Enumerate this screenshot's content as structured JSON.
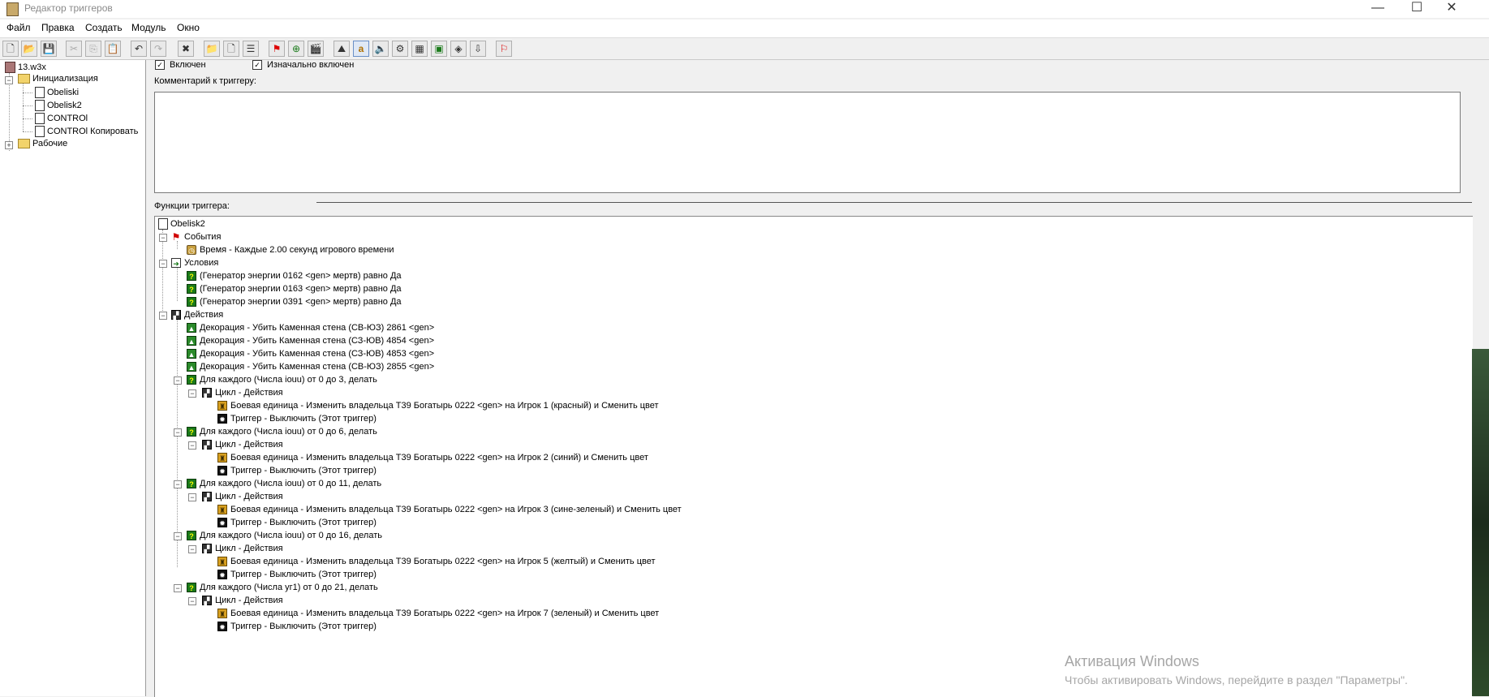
{
  "window": {
    "title": "Редактор триггеров",
    "minimize_glyph": "—",
    "maximize_glyph": "☐",
    "close_glyph": "✕"
  },
  "menu": [
    "Файл",
    "Правка",
    "Создать",
    "Модуль",
    "Окно"
  ],
  "toolbar": {
    "buttons": [
      {
        "name": "new-icon",
        "glyph": "🗋"
      },
      {
        "name": "open-icon",
        "glyph": "📂"
      },
      {
        "name": "save-icon",
        "glyph": "💾"
      },
      {
        "name": "cut-icon",
        "glyph": "✂"
      },
      {
        "name": "copy-icon",
        "glyph": "⎘"
      },
      {
        "name": "paste-icon",
        "glyph": "📋"
      },
      {
        "name": "undo-icon",
        "glyph": "↶"
      },
      {
        "name": "redo-icon",
        "glyph": "↷"
      },
      {
        "name": "delete-icon",
        "glyph": "✖"
      },
      {
        "name": "new-category-icon",
        "glyph": "📁"
      },
      {
        "name": "new-trigger-icon",
        "glyph": "🗋"
      },
      {
        "name": "new-comment-icon",
        "glyph": "☰"
      },
      {
        "name": "new-event-icon",
        "glyph": "⚑"
      },
      {
        "name": "new-condition-icon",
        "glyph": "⊕"
      },
      {
        "name": "new-action-icon",
        "glyph": "🎬"
      },
      {
        "name": "terrain-editor-icon",
        "glyph": "⛰"
      },
      {
        "name": "object-editor-icon",
        "glyph": "a"
      },
      {
        "name": "sound-editor-icon",
        "glyph": "🔈"
      },
      {
        "name": "ability-editor-icon",
        "glyph": "⚙"
      },
      {
        "name": "campaign-editor-icon",
        "glyph": "▦"
      },
      {
        "name": "ai-editor-icon",
        "glyph": "▣"
      },
      {
        "name": "object-manager-icon",
        "glyph": "◈"
      },
      {
        "name": "import-manager-icon",
        "glyph": "⇩"
      },
      {
        "name": "test-map-icon",
        "glyph": "⚐"
      }
    ]
  },
  "tree": {
    "root": "13.w3x",
    "items": [
      {
        "label": "Инициализация",
        "type": "folder",
        "expanded": true,
        "sign": "−"
      },
      {
        "label": "Obeliski",
        "type": "file"
      },
      {
        "label": "Obelisk2",
        "type": "file"
      },
      {
        "label": "CONTROl",
        "type": "file"
      },
      {
        "label": "CONTROl Копировать",
        "type": "file"
      },
      {
        "label": "Рабочие",
        "type": "folder",
        "expanded": false,
        "sign": "+"
      }
    ]
  },
  "trigger": {
    "enabled_label": "Включен",
    "enabled_checked": "✓",
    "initially_enabled_label": "Изначально включен",
    "initially_enabled_checked": "✓",
    "comment_label": "Комментарий к триггеру:",
    "functions_label": "Функции триггера:",
    "comment_text": ""
  },
  "functions": {
    "name": "Obelisk2",
    "events_header": "События",
    "events": [
      "Время - Каждые 2.00 секунд игрового времени"
    ],
    "conditions_header": "Условия",
    "conditions": [
      "(Генератор энергии 0162 <gen> мертв) равно Да",
      "(Генератор энергии 0163 <gen> мертв) равно Да",
      "(Генератор энергии 0391 <gen> мертв) равно Да"
    ],
    "actions_header": "Действия",
    "decor_actions": [
      "Декорация - Убить Каменная стена (СВ-ЮЗ) 2861 <gen>",
      "Декорация - Убить Каменная стена (СЗ-ЮВ) 4854 <gen>",
      "Декорация - Убить Каменная стена (СЗ-ЮВ) 4853 <gen>",
      "Декорация - Убить Каменная стена (СВ-ЮЗ) 2855 <gen>"
    ],
    "loops": [
      {
        "header": "Для каждого (Числа iouu) от 0 до 3, делать",
        "sub": "Цикл - Действия",
        "unit": "Боевая единица - Изменить владельца T39 Богатырь 0222 <gen> на Игрок 1 (красный) и Сменить цвет",
        "trig": "Триггер - Выключить (Этот триггер)"
      },
      {
        "header": "Для каждого (Числа iouu) от 0 до 6, делать",
        "sub": "Цикл - Действия",
        "unit": "Боевая единица - Изменить владельца T39 Богатырь 0222 <gen> на Игрок 2 (синий) и Сменить цвет",
        "trig": "Триггер - Выключить (Этот триггер)"
      },
      {
        "header": "Для каждого (Числа iouu) от 0 до 11, делать",
        "sub": "Цикл - Действия",
        "unit": "Боевая единица - Изменить владельца T39 Богатырь 0222 <gen> на Игрок 3 (сине-зеленый) и Сменить цвет",
        "trig": "Триггер - Выключить (Этот триггер)"
      },
      {
        "header": "Для каждого (Числа iouu) от 0 до 16, делать",
        "sub": "Цикл - Действия",
        "unit": "Боевая единица - Изменить владельца T39 Богатырь 0222 <gen> на Игрок 5 (желтый) и Сменить цвет",
        "trig": "Триггер - Выключить (Этот триггер)"
      },
      {
        "header": "Для каждого (Числа уг1) от 0 до 21, делать",
        "sub": "Цикл - Действия",
        "unit": "Боевая единица - Изменить владельца T39 Богатырь 0222 <gen> на Игрок 7 (зеленый) и Сменить цвет",
        "trig": "Триггер - Выключить (Этот триггер)"
      }
    ]
  },
  "watermark": {
    "title": "Активация Windows",
    "subtitle": "Чтобы активировать Windows, перейдите в раздел \"Параметры\"."
  }
}
